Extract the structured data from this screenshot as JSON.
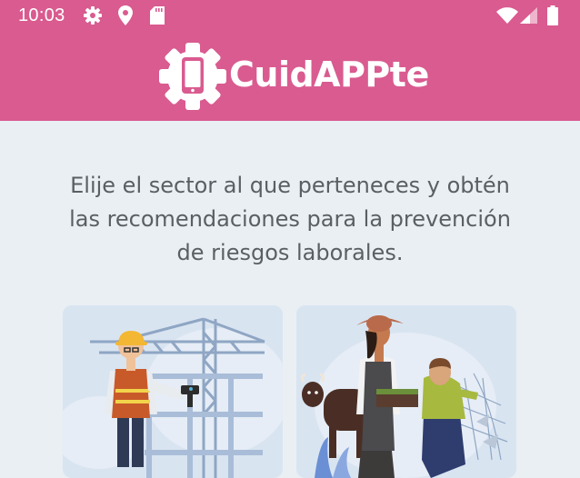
{
  "status_bar": {
    "time": "10:03",
    "left_icons": [
      "gear-icon",
      "location-pin-icon",
      "sd-card-icon"
    ],
    "right_icons": [
      "wifi-icon",
      "signal-icon",
      "battery-icon"
    ]
  },
  "header": {
    "app_name": "CuidAPPte",
    "logo_icon": "gear-phone-icon",
    "background_color": "#d95b90"
  },
  "main": {
    "instruction_text": "Elije el sector al que perteneces y obtén las recomendaciones para la prevención de riesgos laborales."
  },
  "sectors": [
    {
      "id": "construction",
      "illustration": "construction-worker-crane-illustration"
    },
    {
      "id": "agriculture",
      "illustration": "farmer-cow-fisherman-illustration"
    }
  ]
}
